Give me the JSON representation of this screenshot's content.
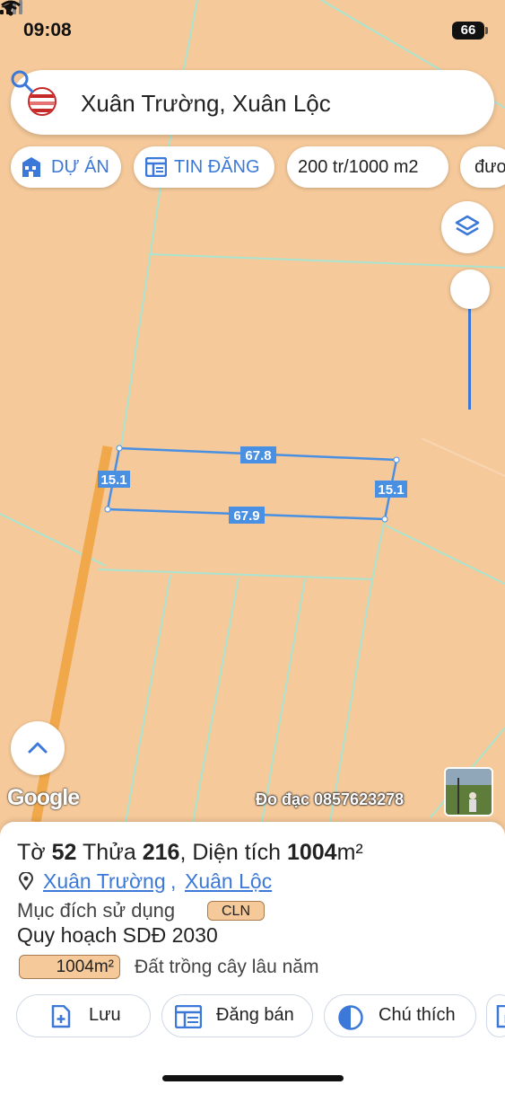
{
  "status": {
    "time": "09:08",
    "battery": "66"
  },
  "search": {
    "text": "Xuân Trường, Xuân Lộc"
  },
  "chips": [
    {
      "label": "DỰ ÁN",
      "icon": "building-icon"
    },
    {
      "label": "TIN ĐĂNG",
      "icon": "listing-icon"
    },
    {
      "label": "200 tr/1000 m2"
    },
    {
      "label": "đươ"
    }
  ],
  "map": {
    "parcel_edges": {
      "top": "67.8",
      "bottom": "67.9",
      "left": "15.1",
      "right": "15.1"
    },
    "attribution": "Google",
    "contact": "Đo đạc 0857623278"
  },
  "parcel": {
    "title_prefix": "Tờ",
    "sheet_no": "52",
    "title_mid": "Thửa",
    "plot_no": "216",
    "area_prefix": ", Diện tích",
    "area": "1004",
    "area_unit": "m²",
    "commune": "Xuân Trường",
    "district": "Xuân Lộc",
    "purpose_label": "Mục đích sử dụng",
    "purpose_code": "CLN",
    "plan_label": "Quy hoạch SDĐ 2030",
    "plan_area": "1004m²",
    "land_type": "Đất trồng cây lâu năm"
  },
  "actions": [
    {
      "label": "Lưu",
      "icon": "add-document-icon"
    },
    {
      "label": "Đăng bán",
      "icon": "listing-icon"
    },
    {
      "label": "Chú thích",
      "icon": "half-circle-icon"
    }
  ],
  "colors": {
    "accent": "#3b78d8",
    "land": "#f5c99a",
    "road": "#f0a84a",
    "boundary": "#a8e4cf"
  }
}
